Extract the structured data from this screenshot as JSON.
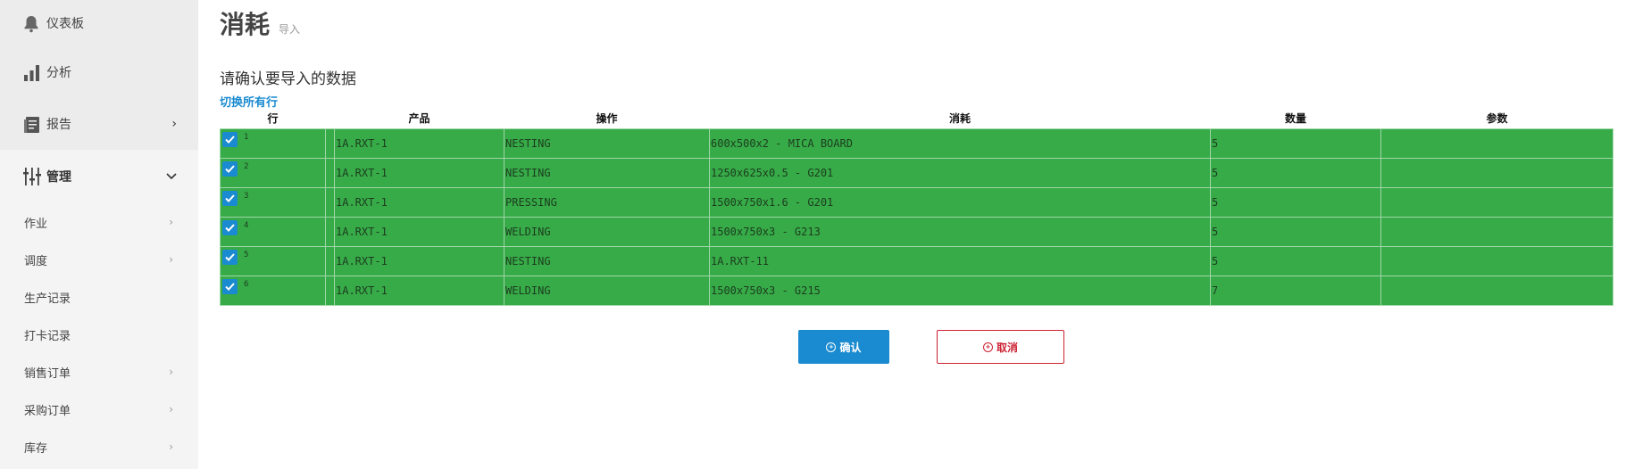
{
  "sidebar": {
    "items": [
      {
        "label": "仪表板",
        "icon": "bell-icon"
      },
      {
        "label": "分析",
        "icon": "bar-chart-icon"
      },
      {
        "label": "报告",
        "icon": "report-icon",
        "chevron": "›"
      },
      {
        "label": "管理",
        "icon": "admin-icon",
        "chevron": "⌄"
      }
    ],
    "subitems": [
      {
        "label": "作业",
        "chevron": "›"
      },
      {
        "label": "调度",
        "chevron": "›"
      },
      {
        "label": "生产记录",
        "chevron": ""
      },
      {
        "label": "打卡记录",
        "chevron": ""
      },
      {
        "label": "销售订单",
        "chevron": "›"
      },
      {
        "label": "采购订单",
        "chevron": "›"
      },
      {
        "label": "库存",
        "chevron": "›"
      }
    ]
  },
  "page": {
    "title": "消耗",
    "subtitle": "导入",
    "heading": "请确认要导入的数据",
    "toggle_all": "切换所有行"
  },
  "table": {
    "headers": [
      "行",
      "产品",
      "操作",
      "消耗",
      "数量",
      "参数"
    ],
    "rows": [
      {
        "row": "1",
        "product": "1A.RXT-1",
        "operation": "NESTING",
        "consumption": "600x500x2 - MICA BOARD",
        "quantity": "5",
        "params": "",
        "checked": true
      },
      {
        "row": "2",
        "product": "1A.RXT-1",
        "operation": "NESTING",
        "consumption": "1250x625x0.5 - G201",
        "quantity": "5",
        "params": "",
        "checked": true
      },
      {
        "row": "3",
        "product": "1A.RXT-1",
        "operation": "PRESSING",
        "consumption": "1500x750x1.6 - G201",
        "quantity": "5",
        "params": "",
        "checked": true
      },
      {
        "row": "4",
        "product": "1A.RXT-1",
        "operation": "WELDING",
        "consumption": "1500x750x3 - G213",
        "quantity": "5",
        "params": "",
        "checked": true
      },
      {
        "row": "5",
        "product": "1A.RXT-1",
        "operation": "NESTING",
        "consumption": "1A.RXT-11",
        "quantity": "5",
        "params": "",
        "checked": true
      },
      {
        "row": "6",
        "product": "1A.RXT-1",
        "operation": "WELDING",
        "consumption": "1500x750x3 - G215",
        "quantity": "7",
        "params": "",
        "checked": true
      }
    ],
    "row_color": "#37ab48"
  },
  "buttons": {
    "confirm": "确认",
    "cancel": "取消"
  },
  "colors": {
    "accent": "#1a8bd0",
    "danger": "#cc2233",
    "row_green": "#37ab48"
  }
}
